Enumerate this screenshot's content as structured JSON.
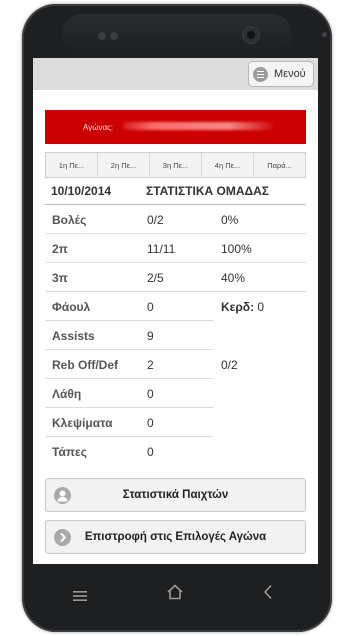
{
  "header": {
    "menu_label": "Μενού"
  },
  "banner": {
    "label": "Αγώνας:"
  },
  "tabs": [
    "1η Πε...",
    "2η Πε...",
    "3η Πε...",
    "4η Πε...",
    "Παρά..."
  ],
  "stats": {
    "date": "10/10/2014",
    "title": "ΣΤΑΤΙΣΤΙΚΑ ΟΜΑΔΑΣ",
    "rows": [
      {
        "label": "Βολές",
        "value": "0/2",
        "extra": "0%"
      },
      {
        "label": "2π",
        "value": "11/11",
        "extra": "100%"
      },
      {
        "label": "3π",
        "value": "2/5",
        "extra": "40%"
      },
      {
        "label": "Φάουλ",
        "value": "0",
        "extra_label": "Κερδ:",
        "extra": "0"
      },
      {
        "label": "Assists",
        "value": "9",
        "extra": ""
      },
      {
        "label": "Reb Off/Def",
        "value": "2",
        "extra": "0/2"
      },
      {
        "label": "Λάθη",
        "value": "0",
        "extra": ""
      },
      {
        "label": "Κλεψίματα",
        "value": "0",
        "extra": ""
      },
      {
        "label": "Τάπες",
        "value": "0",
        "extra": ""
      }
    ]
  },
  "buttons": {
    "player_stats": "Στατιστικά Παιχτών",
    "back": "Επιστροφή στις Επιλογές Αγώνα"
  },
  "icons": {
    "menu": "hamburger-icon",
    "player": "user-icon",
    "back": "chevron-right-icon",
    "nav_menu": "menu-lines-icon",
    "nav_home": "home-icon",
    "nav_back": "back-arrow-icon"
  },
  "colors": {
    "banner": "#cc0000",
    "topbar": "#dcdcdc",
    "phone": "#1d1f21"
  }
}
